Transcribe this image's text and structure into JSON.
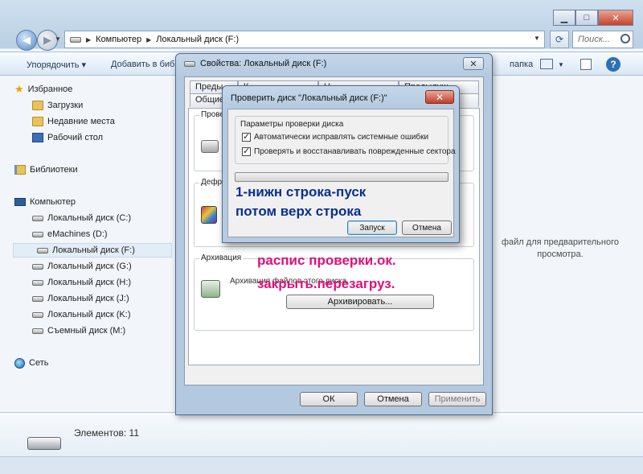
{
  "explorer": {
    "address": {
      "crumbs": [
        "Компьютер",
        "Локальный диск (F:)"
      ]
    },
    "search_placeholder": "Поиск...",
    "commands": {
      "organize": "Упорядочить",
      "add_to_library": "Добавить в биб",
      "new_folder": "папка"
    },
    "nav": {
      "favorites": "Избранное",
      "downloads": "Загрузки",
      "recent": "Недавние места",
      "desktop": "Рабочий стол",
      "libraries": "Библиотеки",
      "computer": "Компьютер",
      "drives": [
        "Локальный диск (C:)",
        "eMachines (D:)",
        "Локальный диск (F:)",
        "Локальный диск (G:)",
        "Локальный диск (H:)",
        "Локальный диск (J:)",
        "Локальный диск (K:)",
        "Съемный диск (M:)"
      ],
      "network": "Сеть"
    },
    "preview_text": "файл для предварительного просмотра.",
    "details": {
      "items_count": "Элементов: 11"
    }
  },
  "properties_dialog": {
    "title": "Свойства: Локальный диск (F:)",
    "tabs_top": [
      "Преды",
      "К",
      "Н",
      "Предыдущ"
    ],
    "tabs_bottom": [
      "Общие",
      "",
      "",
      "ка"
    ],
    "groups": {
      "check": "Прове",
      "defrag": "Дефр",
      "archive": "Архивация"
    },
    "archive_text": "Архивация файлов этого диска",
    "archive_button": "Архивировать...",
    "ok": "ОК",
    "cancel": "Отмена",
    "apply": "Применить"
  },
  "checkdisk_dialog": {
    "title": "Проверить диск \"Локальный диск (F:)\"",
    "group_title": "Параметры проверки диска",
    "option1": "Автоматически исправлять системные ошибки",
    "option2": "Проверять и восстанавливать поврежденные сектора",
    "start": "Запуск",
    "cancel": "Отмена"
  },
  "annotations": {
    "blue_line1": "1-нижн строка-пуск",
    "blue_line2": "потом верх строка",
    "pink_line1": "распис проверки.ок.",
    "pink_line2": "закрыть.перезагруз."
  },
  "colors": {
    "blue_note": "#0a2f8f",
    "pink_note": "#e0107a"
  }
}
